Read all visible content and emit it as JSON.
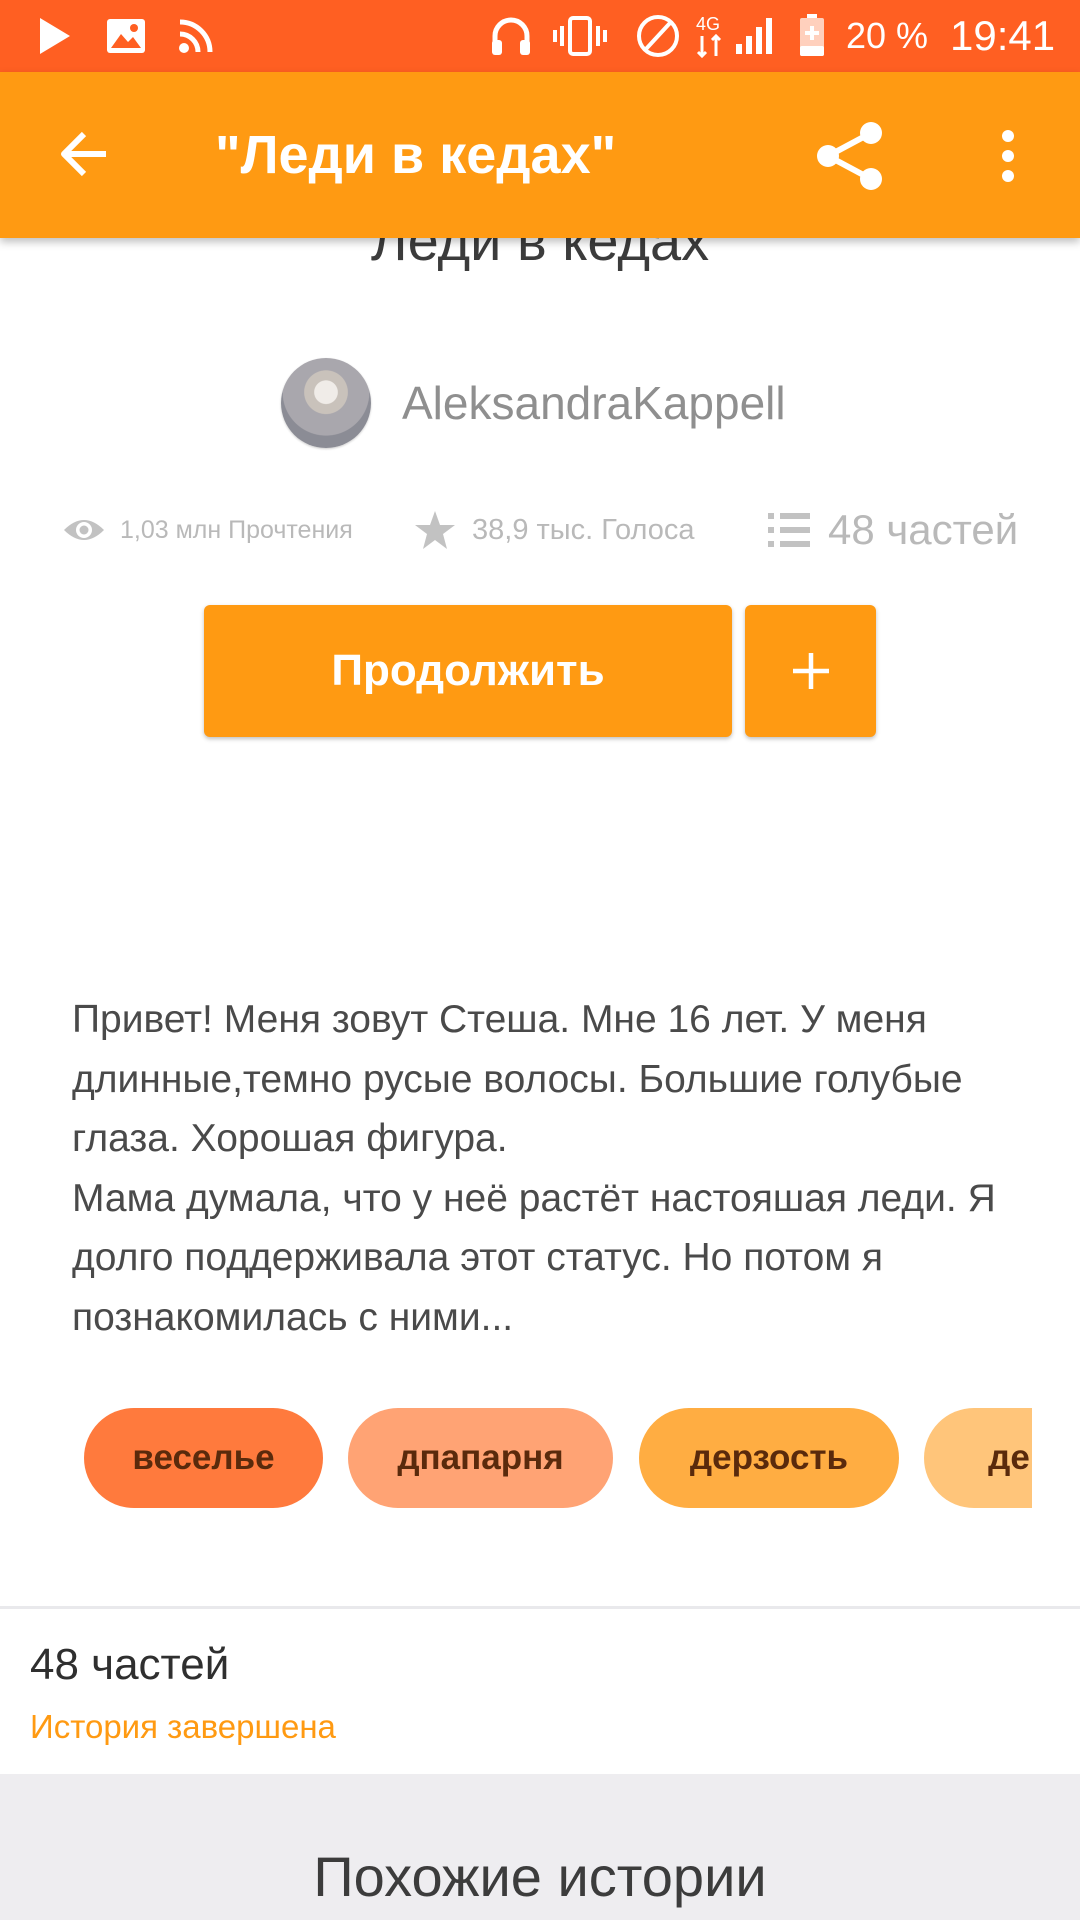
{
  "status_bar": {
    "battery": "20 %",
    "time": "19:41",
    "network": "4G"
  },
  "app_bar": {
    "title": "\"Леди в кедах\""
  },
  "story": {
    "title": "Леди в кедах",
    "author": "AleksandraKappell",
    "stats": {
      "reads": "1,03 млн Прочтения",
      "votes": "38,9 тыс. Голоса",
      "parts": "48 частей"
    },
    "continue_label": "Продолжить",
    "add_label": "+",
    "description_lines": [
      "Привет! Меня зовут Стеша. Мне 16 лет. У меня длинные,темно русые волосы. Большие голубые глаза. Хорошая фигура.",
      "Мама думала, что у неё растёт настояшая леди. Я долго поддерживала этот статус. Но потом я познакомилась с ними..."
    ],
    "tags": [
      {
        "label": "веселье",
        "color": "#ff7a3d"
      },
      {
        "label": "дпапарня",
        "color": "#ffa374"
      },
      {
        "label": "дерзость",
        "color": "#ffad42"
      },
      {
        "label": "де",
        "color": "#ffc57a"
      }
    ]
  },
  "parts_section": {
    "count": "48 частей",
    "status": "История завершена"
  },
  "similar": {
    "title": "Похожие истории"
  },
  "colors": {
    "status_bar": "#ff5f22",
    "accent": "#ff9a12"
  }
}
